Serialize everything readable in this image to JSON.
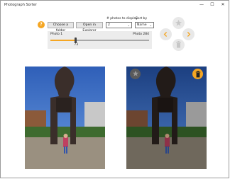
{
  "window": {
    "title": "Photograph Sorter"
  },
  "toolbar": {
    "help_label": "?",
    "choose_folder_label": "Choose a folder",
    "open_explorer_label": "Open in Explorer",
    "photos_to_display_label": "# photos to display",
    "photos_to_display_value": "2",
    "sort_by_label": "Sort by",
    "sort_by_value": "Name"
  },
  "slider": {
    "start_label": "Photo 1",
    "end_label": "Photo 284",
    "current_value": "73",
    "min": 1,
    "max": 284,
    "value": 73
  },
  "colors": {
    "accent": "#f5a623",
    "nav_disabled": "#e8e8e8",
    "nav_icon": "#c7c7c7"
  },
  "icons": {
    "star": "star-icon",
    "delete": "trash-icon"
  }
}
